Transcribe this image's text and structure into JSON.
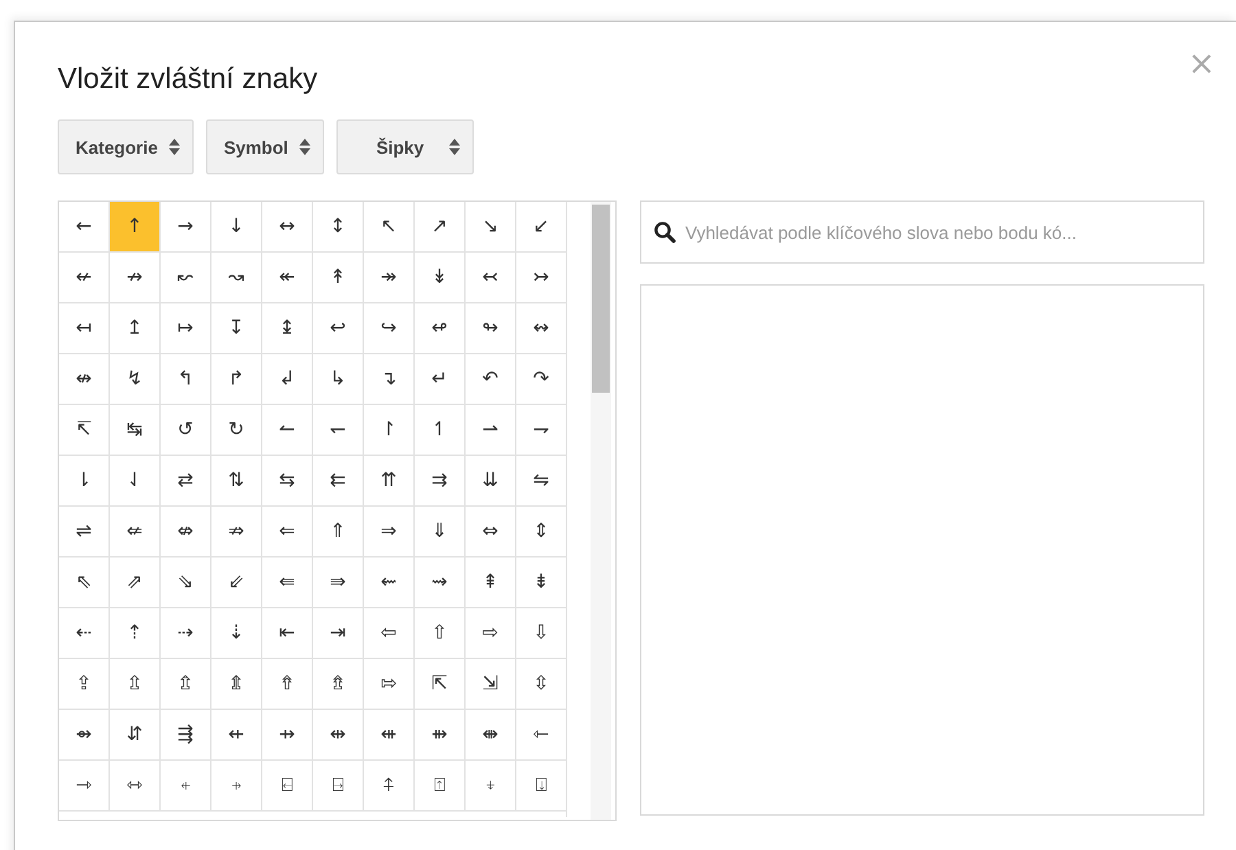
{
  "dialog": {
    "title": "Vložit zvláštní znaky",
    "close": "×"
  },
  "dropdowns": [
    {
      "label": "Kategorie"
    },
    {
      "label": "Symbol"
    },
    {
      "label": "Šipky"
    }
  ],
  "grid": [
    [
      {
        "char": "←",
        "selected": false
      },
      {
        "char": "↑",
        "selected": true
      },
      {
        "char": "→",
        "selected": false
      },
      {
        "char": "↓",
        "selected": false
      },
      {
        "char": "↔",
        "selected": false
      },
      {
        "char": "↕",
        "selected": false
      },
      {
        "char": "↖",
        "selected": false
      },
      {
        "char": "↗",
        "selected": false
      },
      {
        "char": "↘",
        "selected": false
      },
      {
        "char": "↙",
        "selected": false
      }
    ],
    [
      {
        "char": "↚",
        "selected": false
      },
      {
        "char": "↛",
        "selected": false
      },
      {
        "char": "↜",
        "selected": false
      },
      {
        "char": "↝",
        "selected": false
      },
      {
        "char": "↞",
        "selected": false
      },
      {
        "char": "↟",
        "selected": false
      },
      {
        "char": "↠",
        "selected": false
      },
      {
        "char": "↡",
        "selected": false
      },
      {
        "char": "↢",
        "selected": false
      },
      {
        "char": "↣",
        "selected": false
      }
    ],
    [
      {
        "char": "↤",
        "selected": false
      },
      {
        "char": "↥",
        "selected": false
      },
      {
        "char": "↦",
        "selected": false
      },
      {
        "char": "↧",
        "selected": false
      },
      {
        "char": "↨",
        "selected": false
      },
      {
        "char": "↩",
        "selected": false
      },
      {
        "char": "↪",
        "selected": false
      },
      {
        "char": "↫",
        "selected": false
      },
      {
        "char": "↬",
        "selected": false
      },
      {
        "char": "↭",
        "selected": false
      }
    ],
    [
      {
        "char": "↮",
        "selected": false
      },
      {
        "char": "↯",
        "selected": false
      },
      {
        "char": "↰",
        "selected": false
      },
      {
        "char": "↱",
        "selected": false
      },
      {
        "char": "↲",
        "selected": false
      },
      {
        "char": "↳",
        "selected": false
      },
      {
        "char": "↴",
        "selected": false
      },
      {
        "char": "↵",
        "selected": false
      },
      {
        "char": "↶",
        "selected": false
      },
      {
        "char": "↷",
        "selected": false
      }
    ],
    [
      {
        "char": "↸",
        "selected": false
      },
      {
        "char": "↹",
        "selected": false
      },
      {
        "char": "↺",
        "selected": false
      },
      {
        "char": "↻",
        "selected": false
      },
      {
        "char": "↼",
        "selected": false
      },
      {
        "char": "↽",
        "selected": false
      },
      {
        "char": "↾",
        "selected": false
      },
      {
        "char": "↿",
        "selected": false
      },
      {
        "char": "⇀",
        "selected": false
      },
      {
        "char": "⇁",
        "selected": false
      }
    ],
    [
      {
        "char": "⇂",
        "selected": false
      },
      {
        "char": "⇃",
        "selected": false
      },
      {
        "char": "⇄",
        "selected": false
      },
      {
        "char": "⇅",
        "selected": false
      },
      {
        "char": "⇆",
        "selected": false
      },
      {
        "char": "⇇",
        "selected": false
      },
      {
        "char": "⇈",
        "selected": false
      },
      {
        "char": "⇉",
        "selected": false
      },
      {
        "char": "⇊",
        "selected": false
      },
      {
        "char": "⇋",
        "selected": false
      }
    ],
    [
      {
        "char": "⇌",
        "selected": false
      },
      {
        "char": "⇍",
        "selected": false
      },
      {
        "char": "⇎",
        "selected": false
      },
      {
        "char": "⇏",
        "selected": false
      },
      {
        "char": "⇐",
        "selected": false
      },
      {
        "char": "⇑",
        "selected": false
      },
      {
        "char": "⇒",
        "selected": false
      },
      {
        "char": "⇓",
        "selected": false
      },
      {
        "char": "⇔",
        "selected": false
      },
      {
        "char": "⇕",
        "selected": false
      }
    ],
    [
      {
        "char": "⇖",
        "selected": false
      },
      {
        "char": "⇗",
        "selected": false
      },
      {
        "char": "⇘",
        "selected": false
      },
      {
        "char": "⇙",
        "selected": false
      },
      {
        "char": "⇚",
        "selected": false
      },
      {
        "char": "⇛",
        "selected": false
      },
      {
        "char": "⇜",
        "selected": false
      },
      {
        "char": "⇝",
        "selected": false
      },
      {
        "char": "⇞",
        "selected": false
      },
      {
        "char": "⇟",
        "selected": false
      }
    ],
    [
      {
        "char": "⇠",
        "selected": false
      },
      {
        "char": "⇡",
        "selected": false
      },
      {
        "char": "⇢",
        "selected": false
      },
      {
        "char": "⇣",
        "selected": false
      },
      {
        "char": "⇤",
        "selected": false
      },
      {
        "char": "⇥",
        "selected": false
      },
      {
        "char": "⇦",
        "selected": false
      },
      {
        "char": "⇧",
        "selected": false
      },
      {
        "char": "⇨",
        "selected": false
      },
      {
        "char": "⇩",
        "selected": false
      }
    ],
    [
      {
        "char": "⇪",
        "selected": false
      },
      {
        "char": "⇫",
        "selected": false
      },
      {
        "char": "⇬",
        "selected": false
      },
      {
        "char": "⇭",
        "selected": false
      },
      {
        "char": "⇮",
        "selected": false
      },
      {
        "char": "⇯",
        "selected": false
      },
      {
        "char": "⇰",
        "selected": false
      },
      {
        "char": "⇱",
        "selected": false
      },
      {
        "char": "⇲",
        "selected": false
      },
      {
        "char": "⇳",
        "selected": false
      }
    ],
    [
      {
        "char": "⇴",
        "selected": false
      },
      {
        "char": "⇵",
        "selected": false
      },
      {
        "char": "⇶",
        "selected": false
      },
      {
        "char": "⇷",
        "selected": false
      },
      {
        "char": "⇸",
        "selected": false
      },
      {
        "char": "⇹",
        "selected": false
      },
      {
        "char": "⇺",
        "selected": false
      },
      {
        "char": "⇻",
        "selected": false
      },
      {
        "char": "⇼",
        "selected": false
      },
      {
        "char": "⇽",
        "selected": false
      }
    ],
    [
      {
        "char": "⇾",
        "selected": false
      },
      {
        "char": "⇿",
        "selected": false
      },
      {
        "char": "⍅",
        "selected": false
      },
      {
        "char": "⍆",
        "selected": false
      },
      {
        "char": "⍇",
        "selected": false
      },
      {
        "char": "⍈",
        "selected": false
      },
      {
        "char": "⍏",
        "selected": false
      },
      {
        "char": "⍐",
        "selected": false
      },
      {
        "char": "⍖",
        "selected": false
      },
      {
        "char": "⍗",
        "selected": false
      }
    ]
  ],
  "search": {
    "placeholder": "Vyhledávat podle klíčového slova nebo bodu kó..."
  }
}
